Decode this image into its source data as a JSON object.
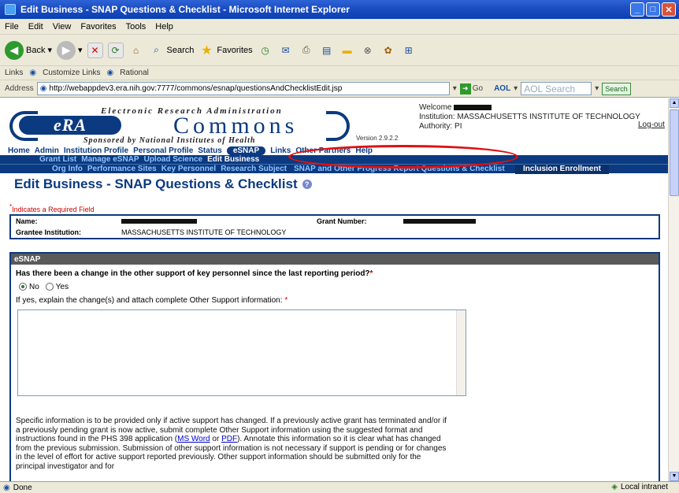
{
  "window": {
    "title": "Edit Business - SNAP Questions & Checklist - Microsoft Internet Explorer"
  },
  "menu": [
    "File",
    "Edit",
    "View",
    "Favorites",
    "Tools",
    "Help"
  ],
  "toolbar": {
    "back": "Back",
    "search": "Search",
    "favorites": "Favorites"
  },
  "links": {
    "label": "Links",
    "items": [
      "Customize Links",
      "Rational"
    ]
  },
  "address": {
    "label": "Address",
    "url": "http://webappdev3.era.nih.gov:7777/commons/esnap/questionsAndChecklistEdit.jsp",
    "go": "Go",
    "aol": "AOL",
    "aol_search_placeholder": "AOL Search",
    "search_btn": "Search"
  },
  "era": {
    "tagline_top": "Electronic Research Administration",
    "logo_short": "eRA",
    "logo_word": "Commons",
    "tagline_bottom": "Sponsored by National Institutes of Health",
    "version": "Version 2.9.2.2",
    "welcome": "Welcome",
    "institution": "Institution: MASSACHUSETTS INSTITUTE OF TECHNOLOGY",
    "authority": "Authority:  PI",
    "logout": "Log-out"
  },
  "nav1": [
    "Home",
    "Admin",
    "Institution Profile",
    "Personal Profile",
    "Status",
    "eSNAP",
    "Links",
    "Other Partners",
    "Help"
  ],
  "nav2": [
    "Grant List",
    "Manage eSNAP",
    "Upload Science",
    "Edit Business"
  ],
  "nav3": {
    "items": [
      "Org Info",
      "Performance Sites",
      "Key Personnel",
      "Research Subject"
    ],
    "snap": "SNAP and Other Progress Report Questions & Checklist",
    "inclusion": "Inclusion Enrollment"
  },
  "page": {
    "title": "Edit Business - SNAP Questions & Checklist",
    "required_note": "Indicates a Required Field"
  },
  "info": {
    "name_label": "Name:",
    "grant_label": "Grant Number:",
    "institution_label": "Grantee Institution:",
    "institution_value": "MASSACHUSETTS INSTITUTE OF TECHNOLOGY"
  },
  "esnap": {
    "section": "eSNAP",
    "question1": "Has there been a change in the other support of key personnel since the last reporting period?",
    "no": "No",
    "yes": "Yes",
    "question2": "If yes, explain the change(s) and attach complete Other Support information:",
    "para_1": "Specific information is to be provided only if active support has changed. If a previously active grant has terminated and/or if a previously pending grant is now active, submit complete Other Support information using the suggested format and instructions found in the PHS 398 application (",
    "link_word": "MS Word",
    "para_or": " or ",
    "link_pdf": "PDF",
    "para_2": "). Annotate this information so it is clear what has changed from the previous submission. Submission of other support information is not necessary if support is pending or for changes in the level of effort for active support reported previously. Other support information should be submitted only for the principal investigator and for"
  },
  "status": {
    "left": "Done",
    "zone": "Local intranet"
  }
}
